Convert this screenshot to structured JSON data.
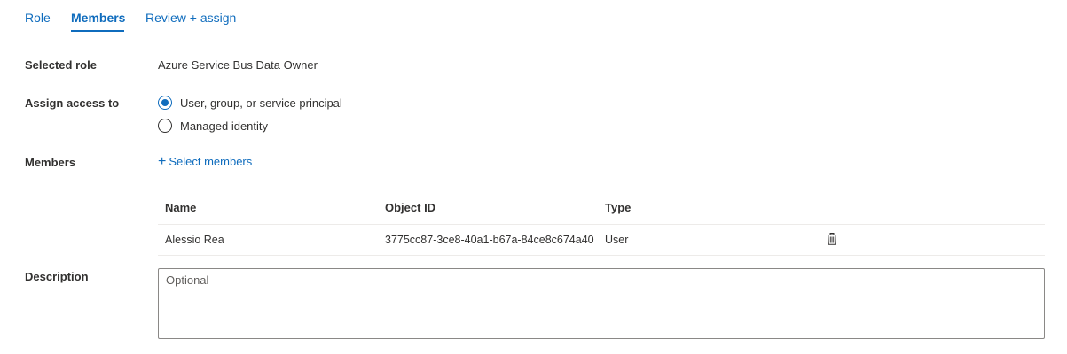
{
  "tabs": [
    {
      "label": "Role"
    },
    {
      "label": "Members",
      "active": true
    },
    {
      "label": "Review + assign"
    }
  ],
  "form": {
    "selected_role": {
      "label": "Selected role",
      "value": "Azure Service Bus Data Owner"
    },
    "assign_access": {
      "label": "Assign access to",
      "options": [
        {
          "label": "User, group, or service principal",
          "checked": true
        },
        {
          "label": "Managed identity",
          "checked": false
        }
      ]
    },
    "members": {
      "label": "Members",
      "select_label": "Select members",
      "icon": "plus-icon",
      "table": {
        "headers": [
          "Name",
          "Object ID",
          "Type"
        ],
        "rows": [
          {
            "name": "Alessio Rea",
            "object_id": "3775cc87-3ce8-40a1-b67a-84ce8c674a40",
            "type": "User",
            "action_icon": "trash-icon"
          }
        ]
      }
    },
    "description": {
      "label": "Description",
      "placeholder": "Optional"
    }
  },
  "colors": {
    "accent": "#0f6cbd",
    "text": "#323130",
    "border": "#8a8886",
    "divider": "#edebe9"
  }
}
